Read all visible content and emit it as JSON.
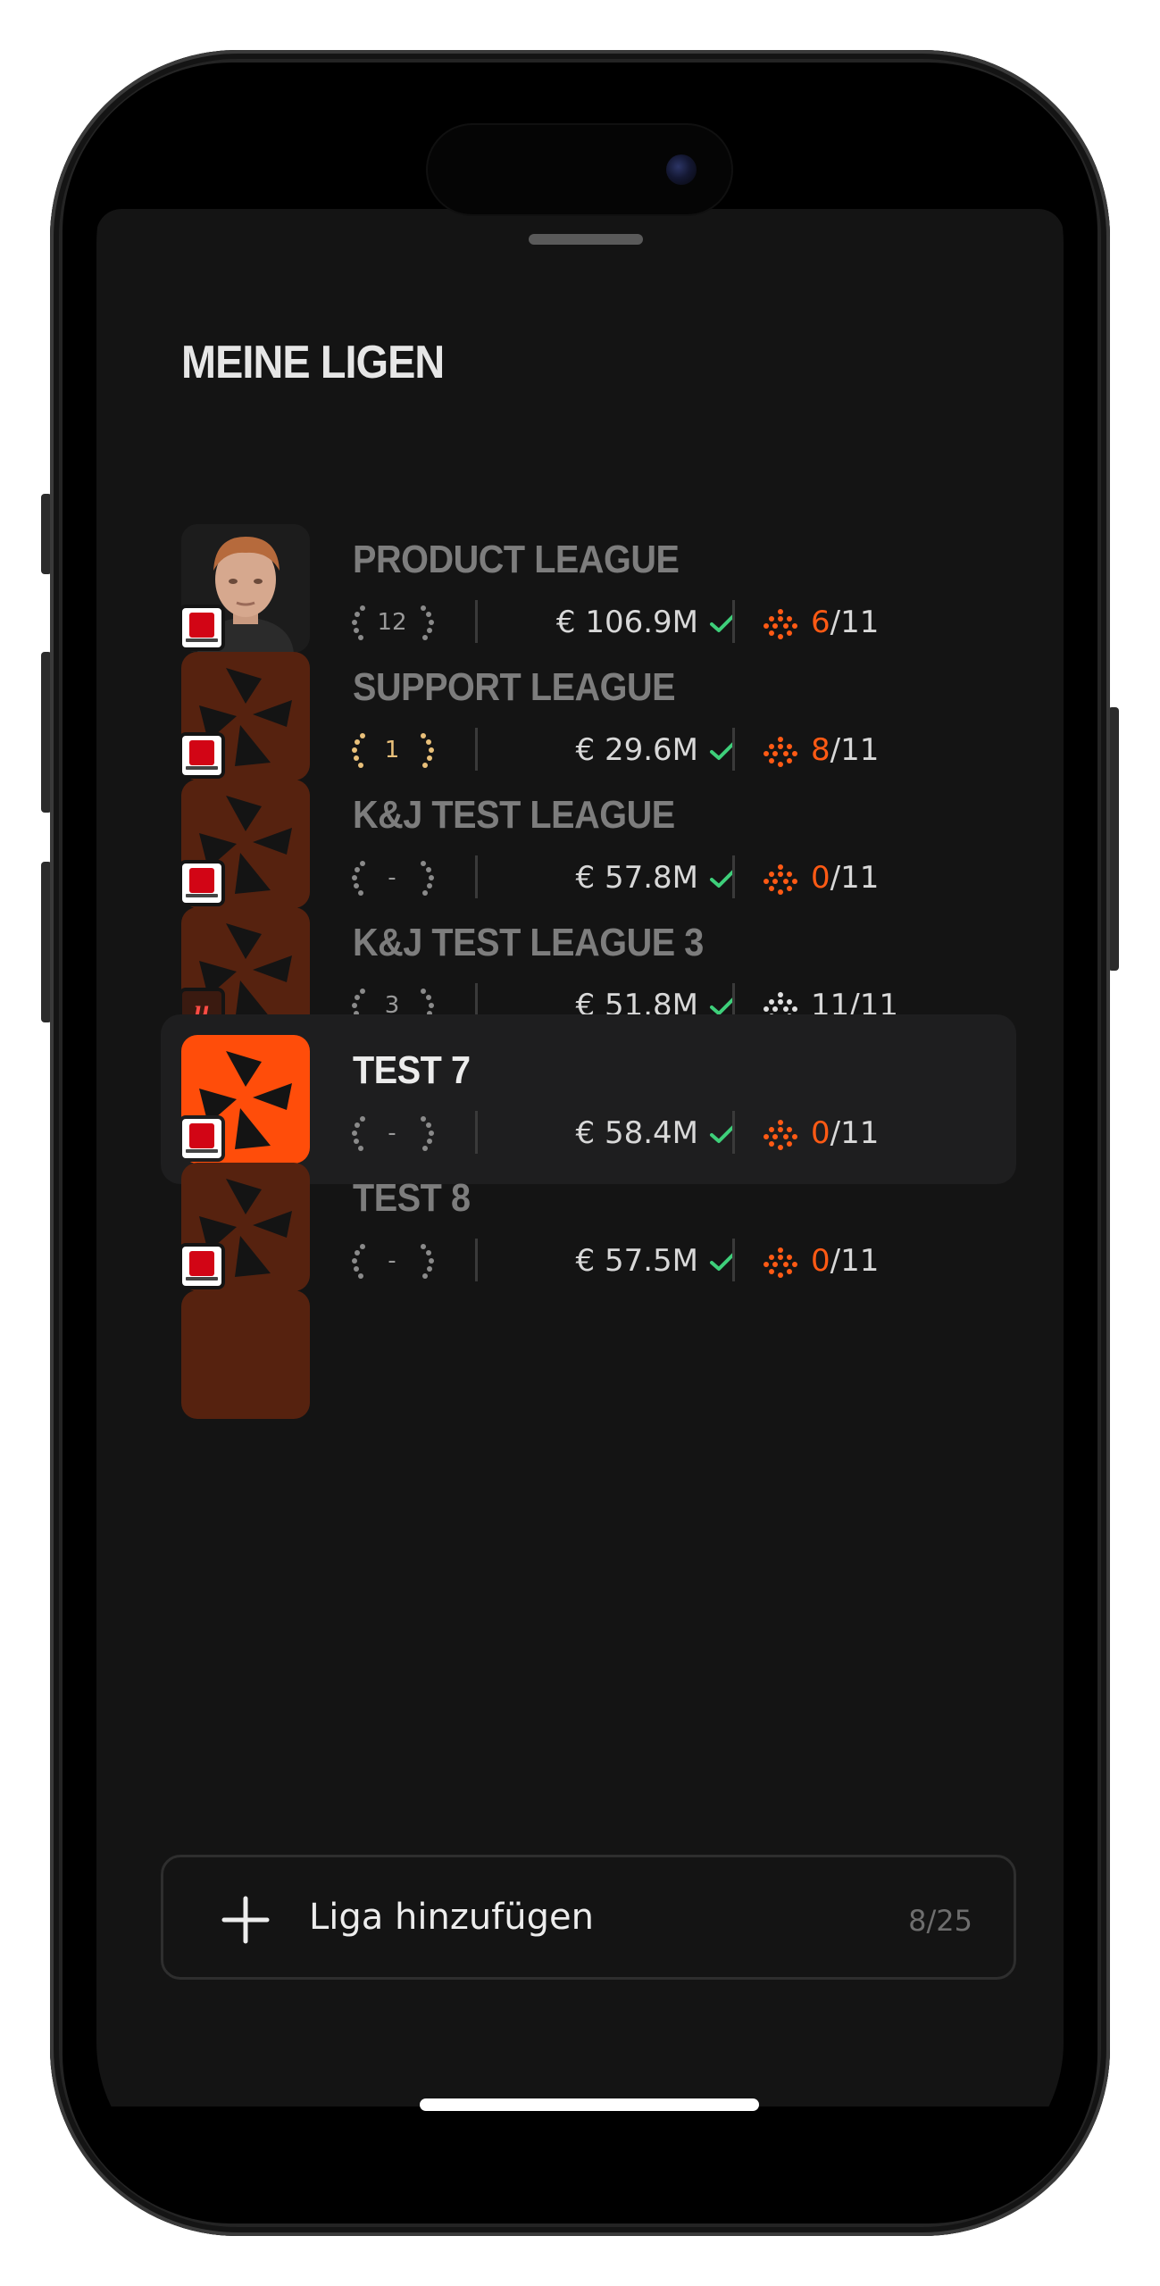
{
  "sheet": {
    "title": "MEINE LIGEN"
  },
  "leagues": [
    {
      "name": "PRODUCT LEAGUE",
      "rank": "12",
      "budget": "€ 106.9M",
      "formation_count": "6",
      "formation_total": "/11",
      "competition": "bundesliga",
      "avatar": "player-photo",
      "selected": false
    },
    {
      "name": "SUPPORT LEAGUE",
      "rank": "1",
      "budget": "€ 29.6M",
      "formation_count": "8",
      "formation_total": "/11",
      "competition": "bundesliga",
      "avatar": "league-logo",
      "selected": false
    },
    {
      "name": "K&J TEST LEAGUE",
      "rank": "-",
      "budget": "€ 57.8M",
      "formation_count": "0",
      "formation_total": "/11",
      "competition": "bundesliga",
      "avatar": "league-logo",
      "selected": false
    },
    {
      "name": "K&J TEST LEAGUE 3",
      "rank": "3",
      "budget": "€ 51.8M",
      "formation_count": "11",
      "formation_total": "/11",
      "competition": "laliga",
      "avatar": "league-logo",
      "selected": false
    },
    {
      "name": "TEST 7",
      "rank": "-",
      "budget": "€ 58.4M",
      "formation_count": "0",
      "formation_total": "/11",
      "competition": "bundesliga",
      "avatar": "league-logo",
      "selected": true
    },
    {
      "name": "TEST 8",
      "rank": "-",
      "budget": "€ 57.5M",
      "formation_count": "0",
      "formation_total": "/11",
      "competition": "bundesliga",
      "avatar": "league-logo",
      "selected": false
    }
  ],
  "add_league": {
    "label": "Liga hinzufügen",
    "count": "8/25"
  },
  "icons": {
    "laliga_glyph": "ɥ",
    "plus": "plus-icon",
    "check": "check-icon",
    "laurel": "laurel-icon",
    "formation": "formation-dots-icon"
  },
  "colors": {
    "accent": "#ff5a14",
    "check": "#3ecf7a",
    "background": "#141414",
    "selected_row": "#1e1e1f",
    "gold": "#e9c07a"
  }
}
